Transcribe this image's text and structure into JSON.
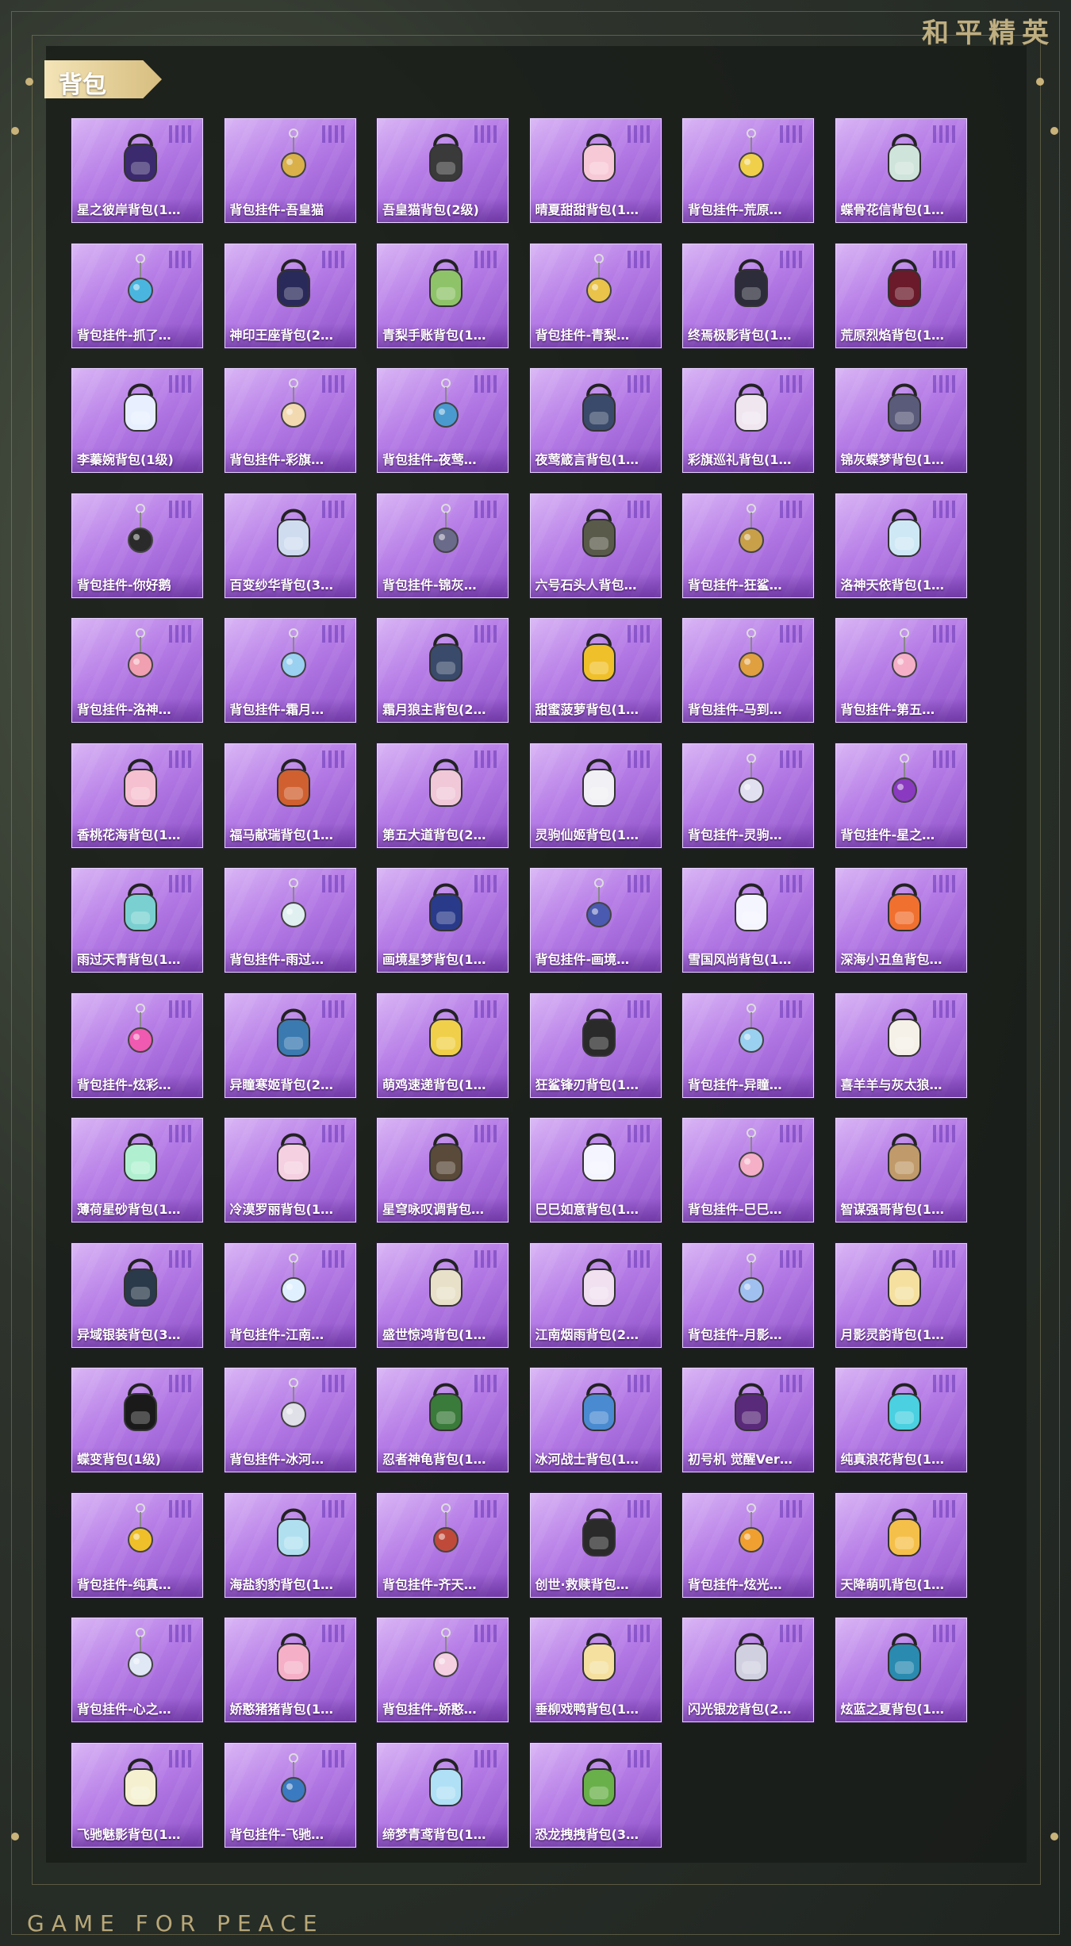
{
  "brand": "和平精英",
  "footer_brand": "GAME FOR PEACE",
  "section_tag": "背包",
  "items": [
    {
      "label": "星之彼岸背包(1…",
      "icon": "backpack-icon",
      "color": "#3b2a6e"
    },
    {
      "label": "背包挂件-吾皇猫",
      "icon": "pendant-icon",
      "color": "#d9b04a"
    },
    {
      "label": "吾皇猫背包(2级)",
      "icon": "backpack-icon",
      "color": "#3a3a3a"
    },
    {
      "label": "晴夏甜甜背包(1…",
      "icon": "backpack-icon",
      "color": "#f7c9d6"
    },
    {
      "label": "背包挂件-荒原…",
      "icon": "pendant-icon",
      "color": "#f0d04a"
    },
    {
      "label": "蝶骨花信背包(1…",
      "icon": "backpack-icon",
      "color": "#cfe4da"
    },
    {
      "label": "背包挂件-抓了…",
      "icon": "pendant-icon",
      "color": "#4ab6e0"
    },
    {
      "label": "神印王座背包(2…",
      "icon": "backpack-icon",
      "color": "#2a2a5a"
    },
    {
      "label": "青梨手账背包(1…",
      "icon": "backpack-icon",
      "color": "#8fc36a"
    },
    {
      "label": "背包挂件-青梨…",
      "icon": "pendant-icon",
      "color": "#e9c34a"
    },
    {
      "label": "终焉极影背包(1…",
      "icon": "backpack-icon",
      "color": "#2c2c3a"
    },
    {
      "label": "荒原烈焰背包(1…",
      "icon": "backpack-icon",
      "color": "#6a1a2a"
    },
    {
      "label": "李蓁婉背包(1级)",
      "icon": "backpack-icon",
      "color": "#e8f0ff"
    },
    {
      "label": "背包挂件-彩旗…",
      "icon": "pendant-icon",
      "color": "#f2d9b0"
    },
    {
      "label": "背包挂件-夜莺…",
      "icon": "pendant-icon",
      "color": "#4a9ad0"
    },
    {
      "label": "夜莺箴言背包(1…",
      "icon": "backpack-icon",
      "color": "#3a4a6a"
    },
    {
      "label": "彩旗巡礼背包(1…",
      "icon": "backpack-icon",
      "color": "#f0e6f0"
    },
    {
      "label": "锦灰蝶梦背包(1…",
      "icon": "backpack-icon",
      "color": "#5a5a7a"
    },
    {
      "label": "背包挂件-你好鹅",
      "icon": "pendant-icon",
      "color": "#2a2a2a"
    },
    {
      "label": "百变纱华背包(3…",
      "icon": "backpack-icon",
      "color": "#cfdcf0"
    },
    {
      "label": "背包挂件-锦灰…",
      "icon": "pendant-icon",
      "color": "#6a6a8a"
    },
    {
      "label": "六号石头人背包…",
      "icon": "backpack-icon",
      "color": "#5a5a4a"
    },
    {
      "label": "背包挂件-狂鲨…",
      "icon": "pendant-icon",
      "color": "#c9a04a"
    },
    {
      "label": "洛神天依背包(1…",
      "icon": "backpack-icon",
      "color": "#cfe8f5"
    },
    {
      "label": "背包挂件-洛神…",
      "icon": "pendant-icon",
      "color": "#f0a0b0"
    },
    {
      "label": "背包挂件-霜月…",
      "icon": "pendant-icon",
      "color": "#9ad0f0"
    },
    {
      "label": "霜月狼主背包(2…",
      "icon": "backpack-icon",
      "color": "#3a4a6a"
    },
    {
      "label": "甜蜜菠萝背包(1…",
      "icon": "backpack-icon",
      "color": "#f0c02a"
    },
    {
      "label": "背包挂件-马到…",
      "icon": "pendant-icon",
      "color": "#e0a040"
    },
    {
      "label": "背包挂件-第五…",
      "icon": "pendant-icon",
      "color": "#f5b0c8"
    },
    {
      "label": "香桃花海背包(1…",
      "icon": "backpack-icon",
      "color": "#f5c0d0"
    },
    {
      "label": "福马献瑞背包(1…",
      "icon": "backpack-icon",
      "color": "#d06030"
    },
    {
      "label": "第五大道背包(2…",
      "icon": "backpack-icon",
      "color": "#f0c8d8"
    },
    {
      "label": "灵驹仙姬背包(1…",
      "icon": "backpack-icon",
      "color": "#f0f0f5"
    },
    {
      "label": "背包挂件-灵驹…",
      "icon": "pendant-icon",
      "color": "#e0e0f0"
    },
    {
      "label": "背包挂件-星之…",
      "icon": "pendant-icon",
      "color": "#8a3ac0"
    },
    {
      "label": "雨过天青背包(1…",
      "icon": "backpack-icon",
      "color": "#7ad0d0"
    },
    {
      "label": "背包挂件-雨过…",
      "icon": "pendant-icon",
      "color": "#e0f0f0"
    },
    {
      "label": "画境星梦背包(1…",
      "icon": "backpack-icon",
      "color": "#2a3a8a"
    },
    {
      "label": "背包挂件-画境…",
      "icon": "pendant-icon",
      "color": "#4a5ab0"
    },
    {
      "label": "雪国风尚背包(1…",
      "icon": "backpack-icon",
      "color": "#f5f5ff"
    },
    {
      "label": "深海小丑鱼背包…",
      "icon": "backpack-icon",
      "color": "#f07030"
    },
    {
      "label": "背包挂件-炫彩…",
      "icon": "pendant-icon",
      "color": "#f05ab0"
    },
    {
      "label": "异瞳寒姬背包(2…",
      "icon": "backpack-icon",
      "color": "#3a7ab0"
    },
    {
      "label": "萌鸡速递背包(1…",
      "icon": "backpack-icon",
      "color": "#f0d04a"
    },
    {
      "label": "狂鲨锋刃背包(1…",
      "icon": "backpack-icon",
      "color": "#2a2a2a"
    },
    {
      "label": "背包挂件-异瞳…",
      "icon": "pendant-icon",
      "color": "#9ad0f0"
    },
    {
      "label": "喜羊羊与灰太狼…",
      "icon": "backpack-icon",
      "color": "#f5f0e8"
    },
    {
      "label": "薄荷星砂背包(1…",
      "icon": "backpack-icon",
      "color": "#b0f0d0"
    },
    {
      "label": "冷漠罗丽背包(1…",
      "icon": "backpack-icon",
      "color": "#f5d0e0"
    },
    {
      "label": "星穹咏叹调背包…",
      "icon": "backpack-icon",
      "color": "#5a4a3a"
    },
    {
      "label": "巳巳如意背包(1…",
      "icon": "backpack-icon",
      "color": "#f5f5ff"
    },
    {
      "label": "背包挂件-巳巳…",
      "icon": "pendant-icon",
      "color": "#f5b0c8"
    },
    {
      "label": "智谋强哥背包(1…",
      "icon": "backpack-icon",
      "color": "#c09a6a"
    },
    {
      "label": "异域银装背包(3…",
      "icon": "backpack-icon",
      "color": "#2a3a4a"
    },
    {
      "label": "背包挂件-江南…",
      "icon": "pendant-icon",
      "color": "#e0f0ff"
    },
    {
      "label": "盛世惊鸿背包(1…",
      "icon": "backpack-icon",
      "color": "#e8e0c8"
    },
    {
      "label": "江南烟雨背包(2…",
      "icon": "backpack-icon",
      "color": "#f0e0f0"
    },
    {
      "label": "背包挂件-月影…",
      "icon": "pendant-icon",
      "color": "#a0c0f0"
    },
    {
      "label": "月影灵韵背包(1…",
      "icon": "backpack-icon",
      "color": "#f5e0a0"
    },
    {
      "label": "蝶变背包(1级)",
      "icon": "backpack-icon",
      "color": "#1a1a1a"
    },
    {
      "label": "背包挂件-冰河…",
      "icon": "pendant-icon",
      "color": "#e0e0e8"
    },
    {
      "label": "忍者神龟背包(1…",
      "icon": "backpack-icon",
      "color": "#3a7a3a"
    },
    {
      "label": "冰河战士背包(1…",
      "icon": "backpack-icon",
      "color": "#4a8ad0"
    },
    {
      "label": "初号机 觉醒Ver…",
      "icon": "backpack-icon",
      "color": "#5a2a7a"
    },
    {
      "label": "纯真浪花背包(1…",
      "icon": "backpack-icon",
      "color": "#4ad0e0"
    },
    {
      "label": "背包挂件-纯真…",
      "icon": "pendant-icon",
      "color": "#f0c02a"
    },
    {
      "label": "海盐豹豹背包(1…",
      "icon": "backpack-icon",
      "color": "#b0e0f0"
    },
    {
      "label": "背包挂件-齐天…",
      "icon": "pendant-icon",
      "color": "#c04a3a"
    },
    {
      "label": "创世·救赎背包…",
      "icon": "backpack-icon",
      "color": "#2a2a2a"
    },
    {
      "label": "背包挂件-炫光…",
      "icon": "pendant-icon",
      "color": "#f0a030"
    },
    {
      "label": "天降萌叽背包(1…",
      "icon": "backpack-icon",
      "color": "#f5c04a"
    },
    {
      "label": "背包挂件-心之…",
      "icon": "pendant-icon",
      "color": "#e0e8f5"
    },
    {
      "label": "娇憨猪猪背包(1…",
      "icon": "backpack-icon",
      "color": "#f5b0c8"
    },
    {
      "label": "背包挂件-娇憨…",
      "icon": "pendant-icon",
      "color": "#f5d0e0"
    },
    {
      "label": "垂柳戏鸭背包(1…",
      "icon": "backpack-icon",
      "color": "#f5e0a0"
    },
    {
      "label": "闪光银龙背包(2…",
      "icon": "backpack-icon",
      "color": "#d0d0e0"
    },
    {
      "label": "炫蓝之夏背包(1…",
      "icon": "backpack-icon",
      "color": "#2a8ab0"
    },
    {
      "label": "飞驰魅影背包(1…",
      "icon": "backpack-icon",
      "color": "#f5f0d0"
    },
    {
      "label": "背包挂件-飞驰…",
      "icon": "pendant-icon",
      "color": "#3a7ac0"
    },
    {
      "label": "缔梦青鸢背包(1…",
      "icon": "backpack-icon",
      "color": "#b0e0f5"
    },
    {
      "label": "恐龙拽拽背包(3…",
      "icon": "backpack-icon",
      "color": "#6ab04a"
    }
  ]
}
